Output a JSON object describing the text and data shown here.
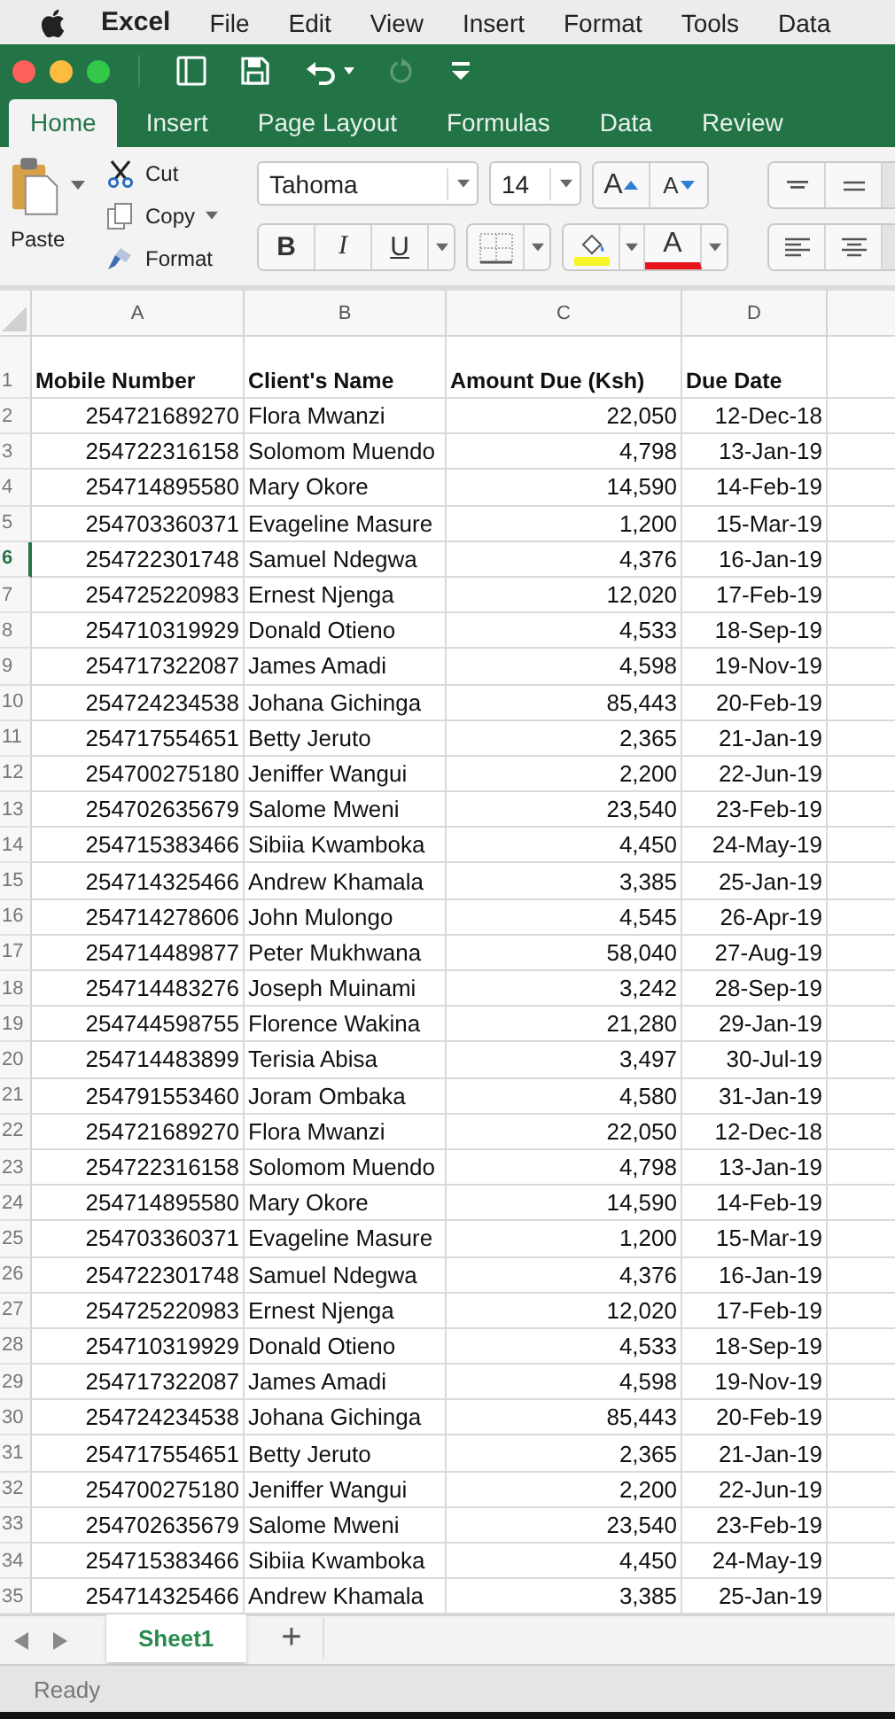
{
  "menu_bar": {
    "app_name": "Excel",
    "menus": [
      "File",
      "Edit",
      "View",
      "Insert",
      "Format",
      "Tools",
      "Data"
    ]
  },
  "ribbon_tabs": [
    {
      "label": "Home",
      "selected": true
    },
    {
      "label": "Insert",
      "selected": false
    },
    {
      "label": "Page Layout",
      "selected": false
    },
    {
      "label": "Formulas",
      "selected": false
    },
    {
      "label": "Data",
      "selected": false
    },
    {
      "label": "Review",
      "selected": false
    }
  ],
  "clipboard": {
    "paste": "Paste",
    "cut": "Cut",
    "copy": "Copy",
    "format": "Format"
  },
  "font": {
    "name": "Tahoma",
    "size": "14",
    "grow": "A",
    "shrink": "A",
    "bold": "B",
    "italic": "I",
    "underline": "U",
    "font_color": "A"
  },
  "columns": [
    "A",
    "B",
    "C",
    "D"
  ],
  "header_row": {
    "number": "1",
    "selected": false,
    "cells": [
      "Mobile Number",
      "Client's Name",
      "Amount Due (Ksh)",
      "Due Date"
    ]
  },
  "rows": [
    {
      "number": "2",
      "selected": false,
      "cells": [
        "254721689270",
        "Flora Mwanzi",
        "22,050",
        "12-Dec-18"
      ]
    },
    {
      "number": "3",
      "selected": false,
      "cells": [
        "254722316158",
        "Solomom Muendo",
        "4,798",
        "13-Jan-19"
      ]
    },
    {
      "number": "4",
      "selected": false,
      "cells": [
        "254714895580",
        "Mary Okore",
        "14,590",
        "14-Feb-19"
      ]
    },
    {
      "number": "5",
      "selected": false,
      "cells": [
        "254703360371",
        "Evageline Masure",
        "1,200",
        "15-Mar-19"
      ]
    },
    {
      "number": "6",
      "selected": true,
      "cells": [
        "254722301748",
        "Samuel Ndegwa",
        "4,376",
        "16-Jan-19"
      ]
    },
    {
      "number": "7",
      "selected": false,
      "cells": [
        "254725220983",
        "Ernest Njenga",
        "12,020",
        "17-Feb-19"
      ]
    },
    {
      "number": "8",
      "selected": false,
      "cells": [
        "254710319929",
        "Donald Otieno",
        "4,533",
        "18-Sep-19"
      ]
    },
    {
      "number": "9",
      "selected": false,
      "cells": [
        "254717322087",
        "James Amadi",
        "4,598",
        "19-Nov-19"
      ]
    },
    {
      "number": "10",
      "selected": false,
      "cells": [
        "254724234538",
        "Johana Gichinga",
        "85,443",
        "20-Feb-19"
      ]
    },
    {
      "number": "11",
      "selected": false,
      "cells": [
        "254717554651",
        "Betty Jeruto",
        "2,365",
        "21-Jan-19"
      ]
    },
    {
      "number": "12",
      "selected": false,
      "cells": [
        "254700275180",
        "Jeniffer Wangui",
        "2,200",
        "22-Jun-19"
      ]
    },
    {
      "number": "13",
      "selected": false,
      "cells": [
        "254702635679",
        "Salome Mweni",
        "23,540",
        "23-Feb-19"
      ]
    },
    {
      "number": "14",
      "selected": false,
      "cells": [
        "254715383466",
        "Sibiia Kwamboka",
        "4,450",
        "24-May-19"
      ]
    },
    {
      "number": "15",
      "selected": false,
      "cells": [
        "254714325466",
        "Andrew Khamala",
        "3,385",
        "25-Jan-19"
      ]
    },
    {
      "number": "16",
      "selected": false,
      "cells": [
        "254714278606",
        "John Mulongo",
        "4,545",
        "26-Apr-19"
      ]
    },
    {
      "number": "17",
      "selected": false,
      "cells": [
        "254714489877",
        "Peter Mukhwana",
        "58,040",
        "27-Aug-19"
      ]
    },
    {
      "number": "18",
      "selected": false,
      "cells": [
        "254714483276",
        "Joseph Muinami",
        "3,242",
        "28-Sep-19"
      ]
    },
    {
      "number": "19",
      "selected": false,
      "cells": [
        "254744598755",
        "Florence Wakina",
        "21,280",
        "29-Jan-19"
      ]
    },
    {
      "number": "20",
      "selected": false,
      "cells": [
        "254714483899",
        "Terisia Abisa",
        "3,497",
        "30-Jul-19"
      ]
    },
    {
      "number": "21",
      "selected": false,
      "cells": [
        "254791553460",
        "Joram Ombaka",
        "4,580",
        "31-Jan-19"
      ]
    },
    {
      "number": "22",
      "selected": false,
      "cells": [
        "254721689270",
        "Flora Mwanzi",
        "22,050",
        "12-Dec-18"
      ]
    },
    {
      "number": "23",
      "selected": false,
      "cells": [
        "254722316158",
        "Solomom Muendo",
        "4,798",
        "13-Jan-19"
      ]
    },
    {
      "number": "24",
      "selected": false,
      "cells": [
        "254714895580",
        "Mary Okore",
        "14,590",
        "14-Feb-19"
      ]
    },
    {
      "number": "25",
      "selected": false,
      "cells": [
        "254703360371",
        "Evageline Masure",
        "1,200",
        "15-Mar-19"
      ]
    },
    {
      "number": "26",
      "selected": false,
      "cells": [
        "254722301748",
        "Samuel Ndegwa",
        "4,376",
        "16-Jan-19"
      ]
    },
    {
      "number": "27",
      "selected": false,
      "cells": [
        "254725220983",
        "Ernest Njenga",
        "12,020",
        "17-Feb-19"
      ]
    },
    {
      "number": "28",
      "selected": false,
      "cells": [
        "254710319929",
        "Donald Otieno",
        "4,533",
        "18-Sep-19"
      ]
    },
    {
      "number": "29",
      "selected": false,
      "cells": [
        "254717322087",
        "James Amadi",
        "4,598",
        "19-Nov-19"
      ]
    },
    {
      "number": "30",
      "selected": false,
      "cells": [
        "254724234538",
        "Johana Gichinga",
        "85,443",
        "20-Feb-19"
      ]
    },
    {
      "number": "31",
      "selected": false,
      "cells": [
        "254717554651",
        "Betty Jeruto",
        "2,365",
        "21-Jan-19"
      ]
    },
    {
      "number": "32",
      "selected": false,
      "cells": [
        "254700275180",
        "Jeniffer Wangui",
        "2,200",
        "22-Jun-19"
      ]
    },
    {
      "number": "33",
      "selected": false,
      "cells": [
        "254702635679",
        "Salome Mweni",
        "23,540",
        "23-Feb-19"
      ]
    },
    {
      "number": "34",
      "selected": false,
      "cells": [
        "254715383466",
        "Sibiia Kwamboka",
        "4,450",
        "24-May-19"
      ]
    },
    {
      "number": "35",
      "selected": false,
      "cells": [
        "254714325466",
        "Andrew Khamala",
        "3,385",
        "25-Jan-19"
      ]
    }
  ],
  "sheet_tabs": [
    {
      "label": "Sheet1",
      "selected": true
    }
  ],
  "add_sheet": "+",
  "status_bar": {
    "text": "Ready"
  }
}
